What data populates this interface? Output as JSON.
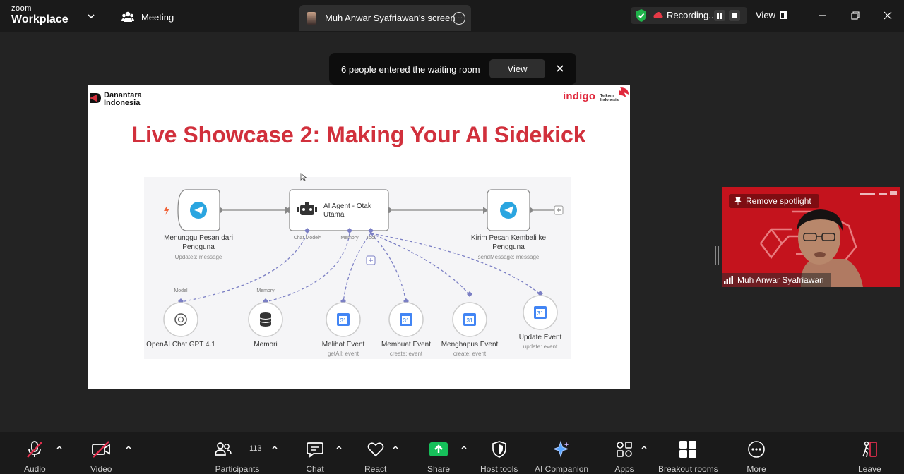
{
  "titlebar": {
    "brand_top": "zoom",
    "brand_bottom": "Workplace",
    "meeting_tab": "Meeting",
    "screen_tab": "Muh Anwar Syafriawan's screen",
    "recording_text": "Recording...",
    "view_label": "View"
  },
  "notification": {
    "message": "6 people entered the waiting room",
    "view_button": "View"
  },
  "slide": {
    "logo_left_line1": "Danantara",
    "logo_left_line2": "Indonesia",
    "logo_right": "indigo",
    "logo_telkom_line1": "Telkom",
    "logo_telkom_line2": "Indonesia",
    "title": "Live Showcase 2: Making Your AI Sidekick",
    "flow": {
      "trigger_label_1": "Menunggu Pesan dari",
      "trigger_label_2": "Pengguna",
      "trigger_sub": "Updates: message",
      "agent_line_1": "AI Agent - Otak",
      "agent_line_2": "Utama",
      "port_chat_model": "Chat Model*",
      "port_memory": "Memory",
      "port_tool": "Tool",
      "send_label_1": "Kirim Pesan Kembali ke",
      "send_label_2": "Pengguna",
      "send_sub": "sendMessage: message",
      "model_conn": "Model",
      "memory_conn": "Memory",
      "nodes": [
        {
          "label": "OpenAI Chat GPT 4.1",
          "sub": ""
        },
        {
          "label": "Memori",
          "sub": ""
        },
        {
          "label": "Melihat Event",
          "sub": "getAll: event"
        },
        {
          "label": "Membuat Event",
          "sub": "create: event"
        },
        {
          "label": "Menghapus Event",
          "sub": "create: event"
        },
        {
          "label": "Update Event",
          "sub": "update: event"
        }
      ]
    }
  },
  "video": {
    "spotlight_button": "Remove spotlight",
    "participant_name": "Muh Anwar Syafriawan",
    "background_color": "#c4131d"
  },
  "toolbar": {
    "audio": "Audio",
    "video": "Video",
    "participants": "Participants",
    "participants_count": "113",
    "chat": "Chat",
    "react": "React",
    "share": "Share",
    "host_tools": "Host tools",
    "ai_companion": "AI Companion",
    "apps": "Apps",
    "breakout_rooms": "Breakout rooms",
    "more": "More",
    "leave": "Leave"
  },
  "colors": {
    "accent_red": "#d1303c",
    "share_green": "#16c05a",
    "mute_red": "#e02e4c",
    "shield_green": "#1fb34a"
  }
}
